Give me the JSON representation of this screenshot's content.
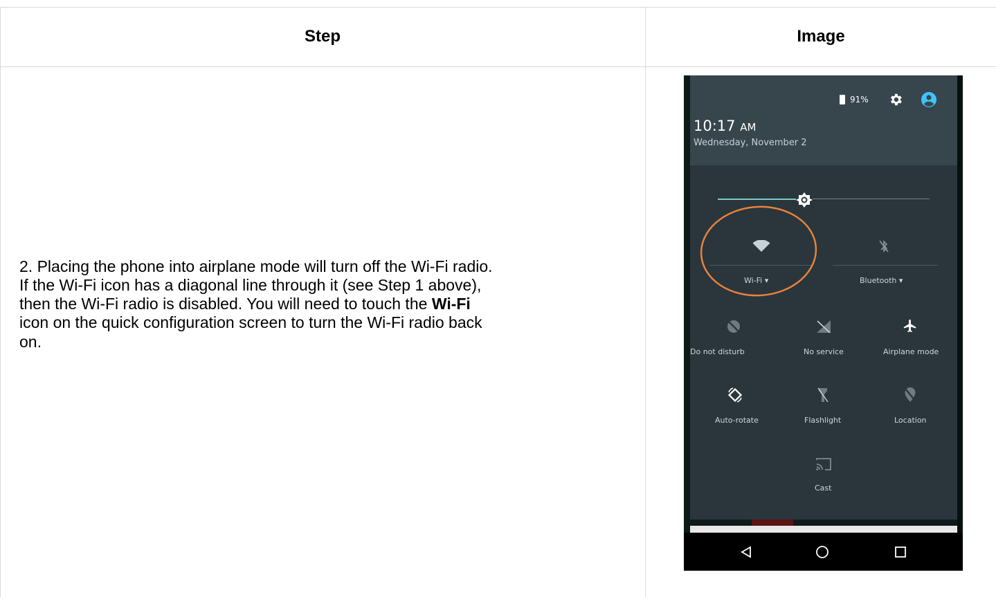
{
  "table": {
    "headers": {
      "step": "Step",
      "image": "Image"
    }
  },
  "step": {
    "part1": "2. Placing the phone into airplane mode will turn off the Wi-Fi radio. If the Wi-Fi icon has a diagonal line through it (see Step 1 above), then the Wi-Fi radio is disabled. You will need to touch the ",
    "bold": "Wi-Fi",
    "part2": " icon on the quick configuration screen to turn the Wi-Fi radio back on."
  },
  "phone": {
    "battery": "91%",
    "time": "10:17",
    "ampm": "AM",
    "date": "Wednesday, November 2",
    "brightness_level": 0.41,
    "tiles": {
      "wifi": "Wi-Fi",
      "bluetooth": "Bluetooth",
      "dnd": "Do not disturb",
      "no_service": "No service",
      "airplane": "Airplane mode",
      "auto_rotate": "Auto-rotate",
      "flashlight": "Flashlight",
      "location": "Location",
      "cast": "Cast"
    },
    "colors": {
      "highlight_circle": "#e8833a",
      "shade": "#2a363c",
      "header": "#37464d",
      "account": "#40c4ff"
    }
  }
}
